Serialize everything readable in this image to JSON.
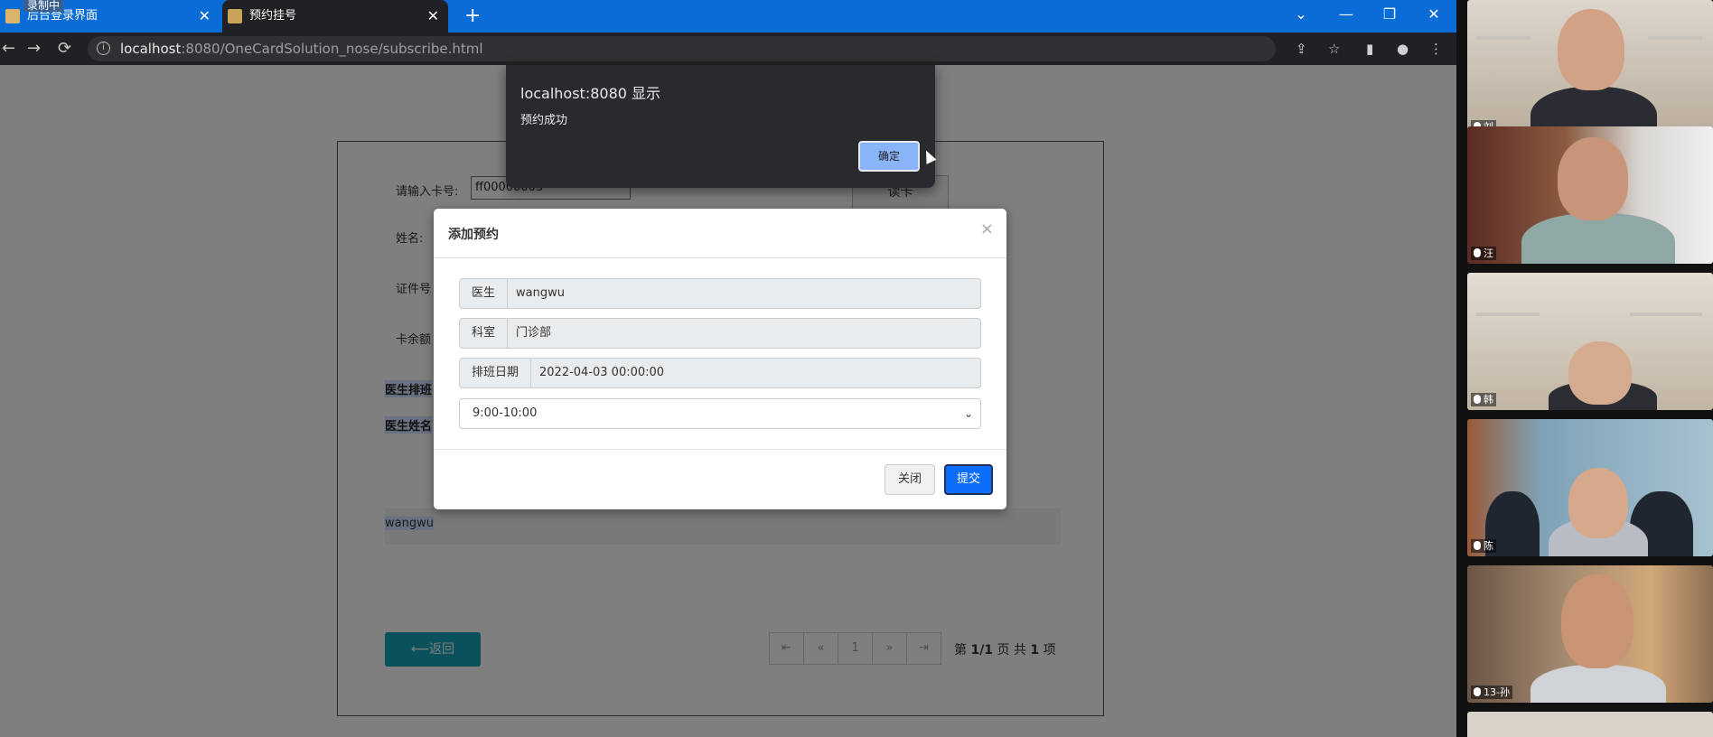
{
  "browser": {
    "tabs": [
      {
        "label": "后台登录界面",
        "close": "✕"
      },
      {
        "label": "预约挂号",
        "close": "✕"
      }
    ],
    "recording_badge": "录制中",
    "new_tab": "+",
    "window_controls": [
      "⌄",
      "—",
      "❐",
      "✕"
    ],
    "nav": {
      "back": "←",
      "forward": "→",
      "reload": "⟳"
    },
    "url": {
      "host": "localhost",
      "rest": ":8080/OneCardSolution_nose/subscribe.html"
    },
    "toolbar_icons": [
      "share-icon",
      "star-icon",
      "sidebar-icon",
      "profile-icon",
      "menu-icon"
    ]
  },
  "form": {
    "card_label": "请输入卡号:",
    "card_value": "ff00000003",
    "read_card_button": "读卡",
    "name_label": "姓名:",
    "id_label": "证件号",
    "balance_label": "卡余额",
    "schedule_heading": "医生排班",
    "doctor_name_heading": "医生姓名",
    "doctor_row_value": "wangwu",
    "back_button": "⟵返回",
    "pager": {
      "first": "⇤",
      "prev": "«",
      "current": "1",
      "next": "»",
      "last": "⇥",
      "page_prefix": "第 ",
      "page_value": "1/1",
      "page_suffix": " 页",
      "total_prefix": "共 ",
      "total_value": "1",
      "total_suffix": " 项"
    }
  },
  "modal": {
    "title": "添加预约",
    "close_icon": "×",
    "fields": [
      {
        "label": "医生",
        "value": "wangwu"
      },
      {
        "label": "科室",
        "value": "门诊部"
      },
      {
        "label": "排班日期",
        "value": "2022-04-03 00:00:00"
      }
    ],
    "time_slot": "9:00-10:00",
    "close_button": "关闭",
    "submit_button": "提交"
  },
  "alert": {
    "origin": "localhost:8080 显示",
    "message": "预约成功",
    "ok_button": "确定"
  },
  "participants": [
    {
      "name": "刘"
    },
    {
      "name": "汪"
    },
    {
      "name": "韩"
    },
    {
      "name": "陈"
    },
    {
      "name": "13-孙"
    }
  ]
}
